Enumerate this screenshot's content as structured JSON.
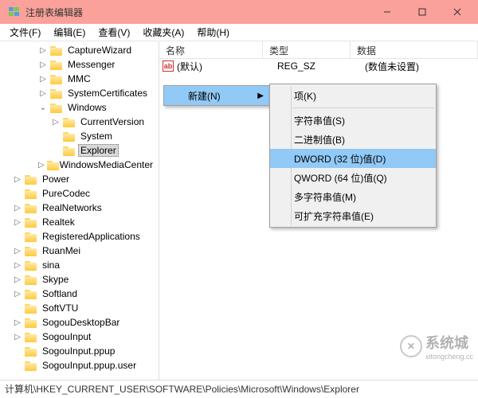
{
  "window": {
    "title": "注册表编辑器"
  },
  "menubar": [
    "文件(F)",
    "编辑(E)",
    "查看(V)",
    "收藏夹(A)",
    "帮助(H)"
  ],
  "tree": [
    {
      "label": "CaptureWizard",
      "indent": 48,
      "exp": "▷"
    },
    {
      "label": "Messenger",
      "indent": 48,
      "exp": "▷"
    },
    {
      "label": "MMC",
      "indent": 48,
      "exp": "▷"
    },
    {
      "label": "SystemCertificates",
      "indent": 48,
      "exp": "▷"
    },
    {
      "label": "Windows",
      "indent": 48,
      "exp": "⌄"
    },
    {
      "label": "CurrentVersion",
      "indent": 64,
      "exp": "▷"
    },
    {
      "label": "System",
      "indent": 64,
      "exp": ""
    },
    {
      "label": "Explorer",
      "indent": 64,
      "exp": "",
      "selected": true
    },
    {
      "label": "WindowsMediaCenter",
      "indent": 48,
      "exp": "▷"
    },
    {
      "label": "Power",
      "indent": 16,
      "exp": "▷"
    },
    {
      "label": "PureCodec",
      "indent": 16,
      "exp": ""
    },
    {
      "label": "RealNetworks",
      "indent": 16,
      "exp": "▷"
    },
    {
      "label": "Realtek",
      "indent": 16,
      "exp": "▷"
    },
    {
      "label": "RegisteredApplications",
      "indent": 16,
      "exp": ""
    },
    {
      "label": "RuanMei",
      "indent": 16,
      "exp": "▷"
    },
    {
      "label": "sina",
      "indent": 16,
      "exp": "▷"
    },
    {
      "label": "Skype",
      "indent": 16,
      "exp": "▷"
    },
    {
      "label": "Softland",
      "indent": 16,
      "exp": "▷"
    },
    {
      "label": "SoftVTU",
      "indent": 16,
      "exp": ""
    },
    {
      "label": "SogouDesktopBar",
      "indent": 16,
      "exp": "▷"
    },
    {
      "label": "SogouInput",
      "indent": 16,
      "exp": "▷"
    },
    {
      "label": "SogouInput.ppup",
      "indent": 16,
      "exp": ""
    },
    {
      "label": "SogouInput.ppup.user",
      "indent": 16,
      "exp": ""
    }
  ],
  "list": {
    "headers": {
      "name": "名称",
      "type": "类型",
      "data": "数据"
    },
    "rows": [
      {
        "name": "(默认)",
        "type": "REG_SZ",
        "data": "(数值未设置)"
      }
    ]
  },
  "contextmenu": {
    "primary": {
      "label": "新建(N)"
    },
    "secondary": [
      {
        "label": "项(K)",
        "sep_after": true
      },
      {
        "label": "字符串值(S)"
      },
      {
        "label": "二进制值(B)"
      },
      {
        "label": "DWORD (32 位)值(D)",
        "hl": true
      },
      {
        "label": "QWORD (64 位)值(Q)"
      },
      {
        "label": "多字符串值(M)"
      },
      {
        "label": "可扩充字符串值(E)"
      }
    ]
  },
  "statusbar": "计算机\\HKEY_CURRENT_USER\\SOFTWARE\\Policies\\Microsoft\\Windows\\Explorer",
  "watermark": {
    "text": "系统城",
    "sub": "xitongcheng.cc"
  }
}
